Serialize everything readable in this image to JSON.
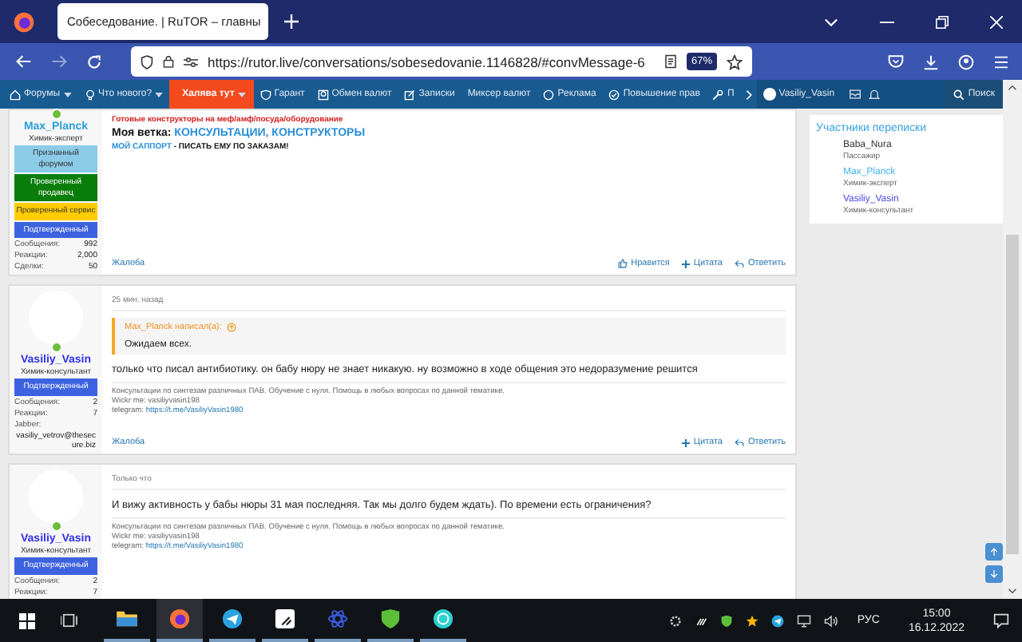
{
  "browser": {
    "tab_title": "Собеседование. | RuTOR – главны",
    "url": "https://rutor.live/conversations/sobesedovanie.1146828/#convMessage-6",
    "zoom": "67%",
    "forward_disabled": true
  },
  "forum_nav": {
    "items": [
      {
        "label": "Форумы",
        "kind": "home",
        "dropdown": true,
        "highlighted": false
      },
      {
        "label": "Что нового?",
        "kind": "bulb",
        "dropdown": true,
        "highlighted": false
      },
      {
        "label": "Халява тут",
        "kind": "plain",
        "dropdown": true,
        "highlighted": true
      },
      {
        "label": "Гарант",
        "kind": "shield",
        "dropdown": false,
        "highlighted": false
      },
      {
        "label": "Обмен валют",
        "kind": "exchange",
        "dropdown": false,
        "highlighted": false
      },
      {
        "label": "Записки",
        "kind": "note",
        "dropdown": false,
        "highlighted": false
      },
      {
        "label": "Миксер валют",
        "kind": "plain",
        "dropdown": false,
        "highlighted": false
      },
      {
        "label": "Реклама",
        "kind": "ad",
        "dropdown": false,
        "highlighted": false
      },
      {
        "label": "Повышение прав",
        "kind": "check",
        "dropdown": false,
        "highlighted": false
      },
      {
        "label": "П",
        "kind": "tool",
        "dropdown": false,
        "highlighted": false
      }
    ],
    "user": "Vasiliy_Vasin",
    "search": "Поиск"
  },
  "posts": [
    {
      "author": {
        "name": "Max_Planck",
        "color": "#2a9fd6",
        "title": "Химик-эксперт",
        "online": true,
        "avatar": false
      },
      "banners": [
        {
          "label": "Признанный форумом",
          "color": "#8ccbe8"
        },
        {
          "label": "Проверенный продавец",
          "color": "#0b7d0b"
        },
        {
          "label": "Проверенный сервис",
          "color": "#ffcc00"
        },
        {
          "label": "Подтвержденный",
          "color": "#3d62e0"
        }
      ],
      "stats": [
        {
          "label": "Сообщения:",
          "value": "992"
        },
        {
          "label": "Реакции:",
          "value": "2,000"
        },
        {
          "label": "Сделки:",
          "value": "50"
        }
      ],
      "content": [
        {
          "kind": "promo",
          "text": "Готовые конструкторы на меф/амф/посуда/оборудование"
        },
        {
          "kind": "heading",
          "lead": "Моя ветка:",
          "link": "КОНСУЛЬТАЦИИ, КОНСТРУКТОРЫ"
        },
        {
          "kind": "support",
          "link": "МОЙ САППОРТ",
          "text": " - ПИСАТЬ ЕМУ ПО ЗАКАЗАМ!"
        }
      ],
      "report": "Жалоба",
      "actions": [
        {
          "label": "Нравится",
          "kind": "like"
        },
        {
          "label": "Цитата",
          "kind": "quote"
        },
        {
          "label": "Ответить",
          "kind": "reply"
        }
      ]
    },
    {
      "time": "25 мин. назад",
      "author": {
        "name": "Vasiliy_Vasin",
        "color": "#3232e6",
        "title": "Химик-консультант",
        "online": true,
        "avatar": true
      },
      "banners": [
        {
          "label": "Подтвержденный",
          "color": "#3d62e0"
        }
      ],
      "stats": [
        {
          "label": "Сообщения:",
          "value": "2"
        },
        {
          "label": "Реакции:",
          "value": "7"
        }
      ],
      "jabber": {
        "label": "Jabber:",
        "value": "vasiliy_vetrov@thesecure.biz"
      },
      "quote": {
        "author": "Max_Planck написал(а):",
        "text": "Ожидаем всех."
      },
      "body": "только что писал антибиотику. он бабу нюру не знает никакую. ну возможно в ходе общения это недоразумение решится",
      "signature": {
        "lines": [
          "Консультации по синтезам различных ПАВ. Обучение с нуля. Помощь в любых вопросах по данной тематике.",
          "Wickr me: vasiliyvasin198"
        ],
        "link_label": "telegram:",
        "link": "https://t.me/VasiliyVasin1980"
      },
      "report": "Жалоба",
      "actions": [
        {
          "label": "Цитата",
          "kind": "quote"
        },
        {
          "label": "Ответить",
          "kind": "reply"
        }
      ]
    },
    {
      "time": "Только что",
      "author": {
        "name": "Vasiliy_Vasin",
        "color": "#3232e6",
        "title": "Химик-консультант",
        "online": true,
        "avatar": true
      },
      "banners": [
        {
          "label": "Подтвержденный",
          "color": "#3d62e0"
        }
      ],
      "stats": [
        {
          "label": "Сообщения:",
          "value": "2"
        },
        {
          "label": "Реакции:",
          "value": "7"
        }
      ],
      "body": "И вижу активность у бабы нюры 31 мая последняя. Так мы долго будем ждать). По времени есть ограничения?",
      "signature": {
        "lines": [
          "Консультации по синтезам различных ПАВ. Обучение с нуля. Помощь в любых вопросах по данной тематике.",
          "Wickr me: vasiliyvasin198"
        ],
        "link_label": "telegram:",
        "link": "https://t.me/VasiliyVasin1980"
      }
    }
  ],
  "sidebar": {
    "title": "Участники переписки",
    "participants": [
      {
        "name": "Baba_Nura",
        "color": "#333333",
        "title": "Пассажир"
      },
      {
        "name": "Max_Planck",
        "color": "#3fb4ef",
        "title": "Химик-эксперт"
      },
      {
        "name": "Vasiliy_Vasin",
        "color": "#4a4ae8",
        "title": "Химик-консультант"
      }
    ]
  },
  "taskbar": {
    "apps": [
      {
        "kind": "explorer",
        "active": false
      },
      {
        "kind": "firefox",
        "active": true
      },
      {
        "kind": "telegram",
        "active": false
      },
      {
        "kind": "notes",
        "active": false
      },
      {
        "kind": "atom",
        "active": false
      },
      {
        "kind": "shield",
        "active": false
      },
      {
        "kind": "circle",
        "active": false
      }
    ],
    "language": "РУС",
    "time": "15:00",
    "date": "16.12.2022"
  }
}
